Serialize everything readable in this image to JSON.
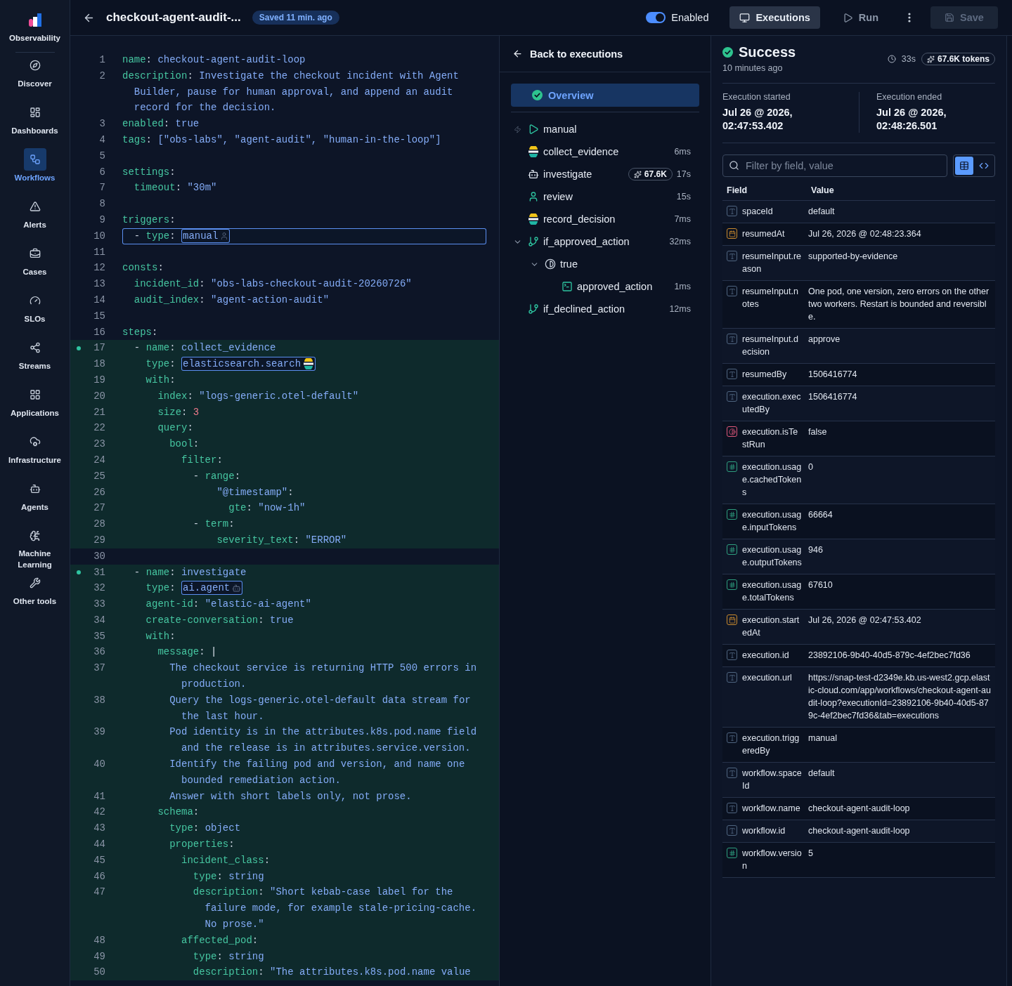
{
  "sidebar": {
    "title": "Observability",
    "items": [
      {
        "label": "Discover",
        "selected": false
      },
      {
        "label": "Dashboards",
        "selected": false
      },
      {
        "label": "Workflows",
        "selected": true
      },
      {
        "label": "Alerts",
        "selected": false
      },
      {
        "label": "Cases",
        "selected": false
      },
      {
        "label": "SLOs",
        "selected": false
      },
      {
        "label": "Streams",
        "selected": false
      },
      {
        "label": "Applications",
        "selected": false
      },
      {
        "label": "Infrastructure",
        "selected": false
      },
      {
        "label": "Agents",
        "selected": false
      },
      {
        "label": "Machine Learning",
        "selected": false
      },
      {
        "label": "Other tools",
        "selected": false
      }
    ]
  },
  "header": {
    "title": "checkout-agent-audit-...",
    "saved": "Saved 11 min. ago",
    "enabled": {
      "label": "Enabled",
      "on": true
    },
    "executions": {
      "label": "Executions",
      "active": true
    },
    "run": "Run",
    "save": {
      "label": "Save",
      "disabled": true
    }
  },
  "editor": {
    "lines": [
      {
        "n": "1",
        "key": "name:",
        "value": "checkout-agent-audit-loop",
        "kind": "text",
        "changed": false,
        "marker": false,
        "focused": false
      },
      {
        "n": "2",
        "key": "description:",
        "value": "Investigate the checkout incident with Agent Builder, pause for human approval, and append an audit record for the decision.",
        "kind": "text",
        "changed": false,
        "marker": false,
        "focused": false
      },
      {
        "n": "3",
        "key": "enabled:",
        "value": "true",
        "kind": "text",
        "changed": false,
        "marker": false,
        "focused": false
      },
      {
        "n": "4",
        "key": "tags:",
        "value": "[\"obs-labs\", \"agent-audit\", \"human-in-the-loop\"]",
        "kind": "text",
        "changed": false,
        "marker": false,
        "focused": false
      },
      {
        "n": "5",
        "changed": false,
        "marker": false,
        "focused": false
      },
      {
        "n": "6",
        "key": "settings:",
        "kind": "key",
        "changed": false,
        "marker": false,
        "focused": false
      },
      {
        "n": "7",
        "key": "  timeout:",
        "value": "\"30m\"",
        "kind": "text",
        "changed": false,
        "marker": false,
        "focused": false
      },
      {
        "n": "8",
        "changed": false,
        "marker": false,
        "focused": false
      },
      {
        "n": "9",
        "key": "triggers:",
        "kind": "key",
        "changed": false,
        "marker": false,
        "focused": false
      },
      {
        "n": "10",
        "key": "  - type:",
        "value": "manual",
        "kind": "trigger",
        "changed": false,
        "marker": false,
        "focused": true
      },
      {
        "n": "11",
        "changed": false,
        "marker": false,
        "focused": false
      },
      {
        "n": "12",
        "key": "consts:",
        "kind": "key",
        "changed": false,
        "marker": false,
        "focused": false
      },
      {
        "n": "13",
        "key": "  incident_id:",
        "value": "\"obs-labs-checkout-audit-20260726\"",
        "kind": "text",
        "changed": false,
        "marker": false,
        "focused": false
      },
      {
        "n": "14",
        "key": "  audit_index:",
        "value": "\"agent-action-audit\"",
        "kind": "text",
        "changed": false,
        "marker": false,
        "focused": false
      },
      {
        "n": "15",
        "changed": false,
        "marker": false,
        "focused": false
      },
      {
        "n": "16",
        "key": "steps:",
        "kind": "key",
        "changed": false,
        "marker": false,
        "focused": false
      },
      {
        "n": "17",
        "key": "  - name:",
        "value": "collect_evidence",
        "kind": "text",
        "changed": true,
        "marker": true,
        "focused": false
      },
      {
        "n": "18",
        "key": "    type:",
        "value": "elasticsearch.search",
        "kind": "search",
        "changed": true,
        "marker": false,
        "focused": false
      },
      {
        "n": "19",
        "key": "    with:",
        "kind": "key",
        "changed": true,
        "marker": false,
        "focused": false
      },
      {
        "n": "20",
        "key": "      index:",
        "value": "\"logs-generic.otel-default\"",
        "kind": "text",
        "changed": true,
        "marker": false,
        "focused": false
      },
      {
        "n": "21",
        "key": "      size:",
        "value": "3",
        "kind": "number",
        "changed": true,
        "marker": false,
        "focused": false
      },
      {
        "n": "22",
        "key": "      query:",
        "kind": "key",
        "changed": true,
        "marker": false,
        "focused": false
      },
      {
        "n": "23",
        "key": "        bool:",
        "kind": "key",
        "changed": true,
        "marker": false,
        "focused": false
      },
      {
        "n": "24",
        "key": "          filter:",
        "kind": "key",
        "changed": true,
        "marker": false,
        "focused": false
      },
      {
        "n": "25",
        "key": "            - range:",
        "kind": "key",
        "changed": true,
        "marker": false,
        "focused": false
      },
      {
        "n": "26",
        "key": "                \"@timestamp\":",
        "kind": "quotedkey",
        "changed": true,
        "marker": false,
        "focused": false
      },
      {
        "n": "27",
        "key": "                  gte:",
        "value": "\"now-1h\"",
        "kind": "text",
        "changed": true,
        "marker": false,
        "focused": false
      },
      {
        "n": "28",
        "key": "            - term:",
        "kind": "key",
        "changed": true,
        "marker": false,
        "focused": false
      },
      {
        "n": "29",
        "key": "                severity_text:",
        "value": "\"ERROR\"",
        "kind": "text",
        "changed": true,
        "marker": false,
        "focused": false
      },
      {
        "n": "30",
        "changed": false,
        "marker": false,
        "focused": false
      },
      {
        "n": "31",
        "key": "  - name:",
        "value": "investigate",
        "kind": "text",
        "changed": true,
        "marker": true,
        "focused": false
      },
      {
        "n": "32",
        "key": "    type:",
        "value": "ai.agent",
        "kind": "agent",
        "changed": true,
        "marker": false,
        "focused": false
      },
      {
        "n": "33",
        "key": "    agent-id:",
        "value": "\"elastic-ai-agent\"",
        "kind": "text",
        "changed": true,
        "marker": false,
        "focused": false
      },
      {
        "n": "34",
        "key": "    create-conversation:",
        "value": "true",
        "kind": "text",
        "changed": true,
        "marker": false,
        "focused": false
      },
      {
        "n": "35",
        "key": "    with:",
        "kind": "key",
        "changed": true,
        "marker": false,
        "focused": false
      },
      {
        "n": "36",
        "key": "      message:",
        "value": "|",
        "kind": "plain",
        "changed": true,
        "marker": false,
        "focused": false
      },
      {
        "n": "37",
        "value": "        The checkout service is returning HTTP 500 errors in production.",
        "kind": "text",
        "changed": true,
        "marker": false,
        "focused": false
      },
      {
        "n": "38",
        "value": "        Query the logs-generic.otel-default data stream for the last hour.",
        "kind": "text",
        "changed": true,
        "marker": false,
        "focused": false
      },
      {
        "n": "39",
        "value": "        Pod identity is in the attributes.k8s.pod.name field and the release is in attributes.service.version.",
        "kind": "text",
        "changed": true,
        "marker": false,
        "focused": false
      },
      {
        "n": "40",
        "value": "        Identify the failing pod and version, and name one bounded remediation action.",
        "kind": "text",
        "changed": true,
        "marker": false,
        "focused": false
      },
      {
        "n": "41",
        "value": "        Answer with short labels only, not prose.",
        "kind": "text",
        "changed": true,
        "marker": false,
        "focused": false
      },
      {
        "n": "42",
        "key": "      schema:",
        "kind": "key",
        "changed": true,
        "marker": false,
        "focused": false
      },
      {
        "n": "43",
        "key": "        type:",
        "value": "object",
        "kind": "text",
        "changed": true,
        "marker": false,
        "focused": false
      },
      {
        "n": "44",
        "key": "        properties:",
        "kind": "key",
        "changed": true,
        "marker": false,
        "focused": false
      },
      {
        "n": "45",
        "key": "          incident_class:",
        "kind": "key",
        "changed": true,
        "marker": false,
        "focused": false
      },
      {
        "n": "46",
        "key": "            type:",
        "value": "string",
        "kind": "text",
        "changed": true,
        "marker": false,
        "focused": false
      },
      {
        "n": "47",
        "key": "            description:",
        "value": "\"Short kebab-case label for the failure mode, for example stale-pricing-cache. No prose.\"",
        "kind": "text",
        "changed": true,
        "marker": false,
        "focused": false
      },
      {
        "n": "48",
        "key": "          affected_pod:",
        "kind": "key",
        "changed": true,
        "marker": false,
        "focused": false
      },
      {
        "n": "49",
        "key": "            type:",
        "value": "string",
        "kind": "text",
        "changed": true,
        "marker": false,
        "focused": false
      },
      {
        "n": "50",
        "key": "            description:",
        "value": "\"The attributes.k8s.pod.name value",
        "kind": "text",
        "changed": true,
        "marker": false,
        "focused": false
      }
    ]
  },
  "tree": {
    "back": "Back to executions",
    "overview": {
      "label": "Overview",
      "selected": true
    },
    "items": [
      {
        "kind": "trigger",
        "name": "manual",
        "selected": false
      },
      {
        "kind": "search",
        "name": "collect_evidence",
        "duration": "6ms",
        "selected": false
      },
      {
        "kind": "agent",
        "name": "investigate",
        "tokens": "67.6K",
        "duration": "17s",
        "selected": false
      },
      {
        "kind": "human",
        "name": "review",
        "duration": "15s",
        "selected": false
      },
      {
        "kind": "search",
        "name": "record_decision",
        "duration": "7ms",
        "selected": false
      },
      {
        "kind": "branch",
        "name": "if_approved_action",
        "duration": "32ms",
        "expanded": true,
        "selected": false,
        "children": [
          {
            "kind": "condition",
            "name": "true",
            "expanded": true,
            "selected": false,
            "children": [
              {
                "kind": "console",
                "name": "approved_action",
                "duration": "1ms",
                "selected": false
              }
            ]
          }
        ]
      },
      {
        "kind": "branch",
        "name": "if_declined_action",
        "duration": "12ms",
        "selected": false
      }
    ]
  },
  "details": {
    "status": "Success",
    "ago": "10 minutes ago",
    "duration": "33s",
    "tokens": "67.6K tokens",
    "started": {
      "label": "Execution started",
      "value": "Jul 26 @ 2026, 02:47:53.402"
    },
    "ended": {
      "label": "Execution ended",
      "value": "Jul 26 @ 2026, 02:48:26.501"
    },
    "filter": {
      "placeholder": "Filter by field, value"
    },
    "views": [
      {
        "kind": "table",
        "selected": true
      },
      {
        "kind": "code",
        "selected": false
      }
    ],
    "columns": [
      "Field",
      "Value"
    ],
    "rows": [
      {
        "kind": "text",
        "field": "spaceId",
        "value": "default"
      },
      {
        "kind": "date",
        "field": "resumedAt",
        "value": "Jul 26, 2026 @ 02:48:23.364"
      },
      {
        "kind": "text",
        "field": "resumeInput.reason",
        "value": "supported-by-evidence"
      },
      {
        "kind": "text",
        "field": "resumeInput.notes",
        "value": "One pod, one version, zero errors on the other two workers. Restart is bounded and reversible."
      },
      {
        "kind": "text",
        "field": "resumeInput.decision",
        "value": "approve"
      },
      {
        "kind": "text",
        "field": "resumedBy",
        "value": "1506416774"
      },
      {
        "kind": "text",
        "field": "execution.executedBy",
        "value": "1506416774"
      },
      {
        "kind": "boolean",
        "field": "execution.isTestRun",
        "value": "false"
      },
      {
        "kind": "number",
        "field": "execution.usage.cachedTokens",
        "value": "0"
      },
      {
        "kind": "number",
        "field": "execution.usage.inputTokens",
        "value": "66664"
      },
      {
        "kind": "number",
        "field": "execution.usage.outputTokens",
        "value": "946"
      },
      {
        "kind": "number",
        "field": "execution.usage.totalTokens",
        "value": "67610"
      },
      {
        "kind": "date",
        "field": "execution.startedAt",
        "value": "Jul 26, 2026 @ 02:47:53.402"
      },
      {
        "kind": "text",
        "field": "execution.id",
        "value": "23892106-9b40-40d5-879c-4ef2bec7fd36"
      },
      {
        "kind": "text",
        "field": "execution.url",
        "value": "https://snap-test-d2349e.kb.us-west2.gcp.elastic-cloud.com/app/workflows/checkout-agent-audit-loop?executionId=23892106-9b40-40d5-879c-4ef2bec7fd36&tab=executions"
      },
      {
        "kind": "text",
        "field": "execution.triggeredBy",
        "value": "manual"
      },
      {
        "kind": "text",
        "field": "workflow.spaceId",
        "value": "default"
      },
      {
        "kind": "text",
        "field": "workflow.name",
        "value": "checkout-agent-audit-loop"
      },
      {
        "kind": "text",
        "field": "workflow.id",
        "value": "checkout-agent-audit-loop"
      },
      {
        "kind": "number",
        "field": "workflow.version",
        "value": "5"
      }
    ]
  }
}
